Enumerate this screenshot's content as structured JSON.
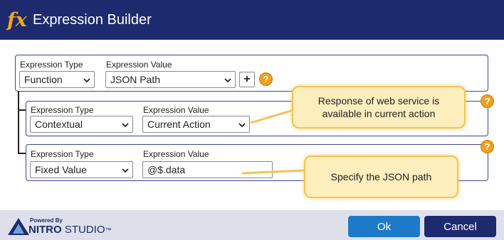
{
  "window": {
    "title": "Expression Builder",
    "fx_icon": "fx"
  },
  "row1": {
    "type_label": "Expression Type",
    "type_value": "Function",
    "value_label": "Expression Value",
    "value_value": "JSON Path",
    "add_symbol": "+",
    "help_symbol": "?"
  },
  "row2": {
    "type_label": "Expression Type",
    "type_value": "Contextual",
    "value_label": "Expression Value",
    "value_value": "Current Action",
    "help_symbol": "?"
  },
  "row3": {
    "type_label": "Expression Type",
    "type_value": "Fixed Value",
    "value_label": "Expression Value",
    "input_value": "@$.data",
    "help_symbol": "?"
  },
  "callouts": {
    "response": "Response of web service is available in current action",
    "json_path": "Specify the JSON path"
  },
  "footer": {
    "powered_by": "Powered By",
    "brand_bold": "NITRO",
    "brand_rest": "STUDIO",
    "tm": "™",
    "ok": "Ok",
    "cancel": "Cancel"
  },
  "colors": {
    "title_bar": "#1e2a6e",
    "fx_icon": "#f3a71b",
    "help_icon": "#f0a01e",
    "callout_fill": "#fdeebd",
    "ok_button": "#1e7ac8",
    "cancel_button": "#1e2a6e",
    "footer_bg": "#dde0ea"
  }
}
